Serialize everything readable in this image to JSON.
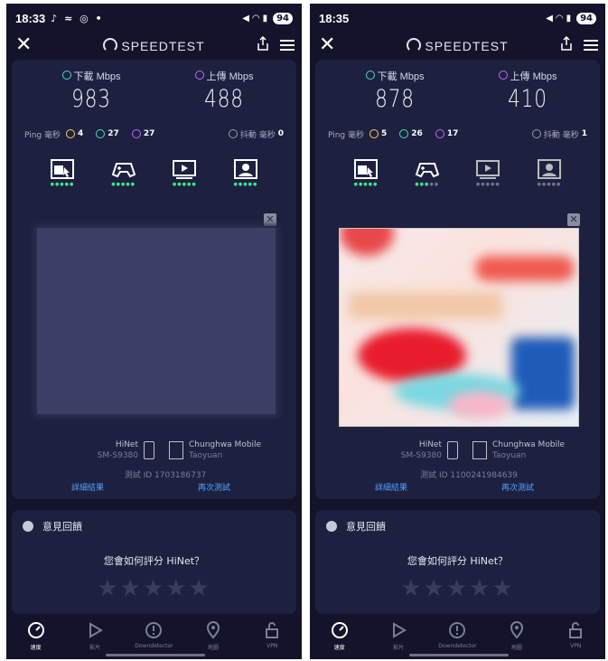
{
  "screens": [
    {
      "status": {
        "time": "18:33",
        "left_icons": "♪ ≈ ◎ •",
        "battery": "94"
      },
      "app_title": "SPEEDTEST",
      "download": {
        "label": "下載 Mbps",
        "value": "983"
      },
      "upload": {
        "label": "上傳 Mbps",
        "value": "488"
      },
      "ping": {
        "label": "Ping 毫秒",
        "idle": "4",
        "down": "27",
        "up": "27",
        "jitter_label": "抖動 毫秒",
        "jitter": "0"
      },
      "ad_state": "blank",
      "isp": {
        "name": "HiNet",
        "device": "SM-S9380"
      },
      "server": {
        "name": "Chunghwa Mobile",
        "city": "Taoyuan"
      },
      "result_id": "測試 ID 1703186737",
      "details_link": "詳細結果",
      "retest_link": "再次測試",
      "feedback": {
        "title": "意見回饋",
        "question": "您會如何評分 HiNet？"
      },
      "nav": [
        "速度",
        "影片",
        "Downdetector",
        "地圖",
        "VPN"
      ]
    },
    {
      "status": {
        "time": "18:35",
        "left_icons": "",
        "battery": "94"
      },
      "app_title": "SPEEDTEST",
      "download": {
        "label": "下載 Mbps",
        "value": "878"
      },
      "upload": {
        "label": "上傳 Mbps",
        "value": "410"
      },
      "ping": {
        "label": "Ping 毫秒",
        "idle": "5",
        "down": "26",
        "up": "17",
        "jitter_label": "抖動 毫秒",
        "jitter": "1"
      },
      "ad_state": "image",
      "isp": {
        "name": "HiNet",
        "device": "SM-S9380"
      },
      "server": {
        "name": "Chunghwa Mobile",
        "city": "Taoyuan"
      },
      "result_id": "測試 ID 1100241984639",
      "details_link": "詳細結果",
      "retest_link": "再次測試",
      "feedback": {
        "title": "意見回饋",
        "question": "您會如何評分 HiNet？"
      },
      "nav": [
        "速度",
        "影片",
        "Downdetector",
        "地圖",
        "VPN"
      ]
    }
  ],
  "colors": {
    "bg": "#13142b",
    "card": "#1e2040",
    "download_accent": "#3fe0c0",
    "upload_accent": "#c467ff",
    "link": "#4ea3ff"
  }
}
